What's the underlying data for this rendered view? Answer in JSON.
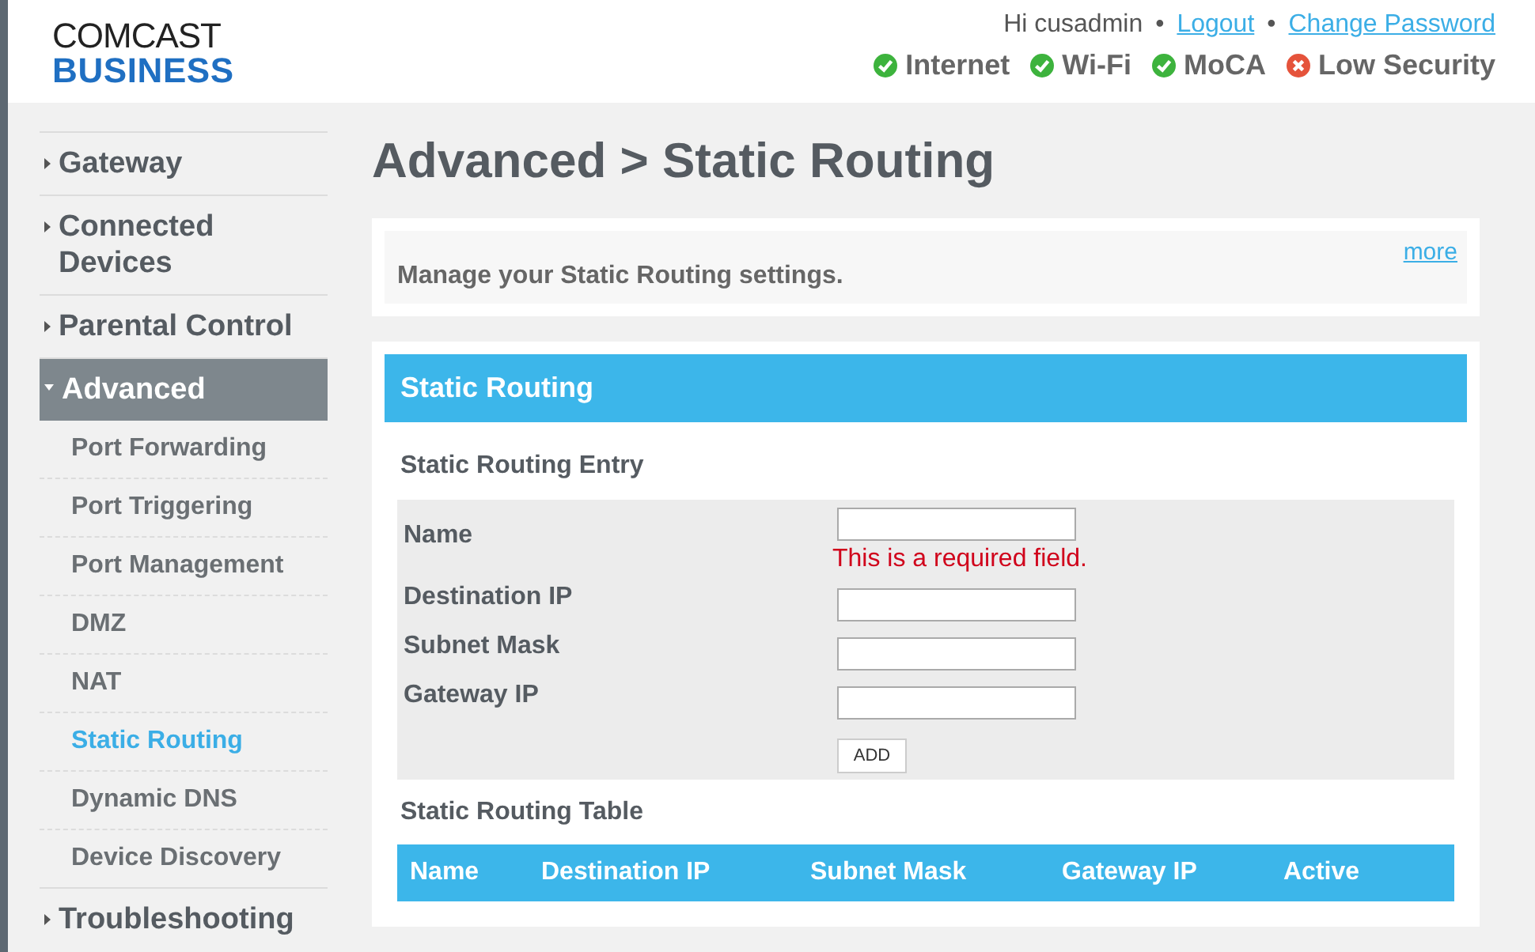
{
  "logo": {
    "line1": "COMCAST",
    "line2": "BUSINESS"
  },
  "user": {
    "greeting": "Hi cusadmin",
    "separator": "•",
    "logout": "Logout",
    "change_password": "Change Password"
  },
  "status": [
    {
      "label": "Internet",
      "kind": "ok"
    },
    {
      "label": "Wi-Fi",
      "kind": "ok"
    },
    {
      "label": "MoCA",
      "kind": "ok"
    },
    {
      "label": "Low Security",
      "kind": "error"
    }
  ],
  "sidebar": {
    "items": [
      {
        "label": "Gateway",
        "expanded": false,
        "selected": false
      },
      {
        "label": "Connected Devices",
        "expanded": false,
        "selected": false
      },
      {
        "label": "Parental Control",
        "expanded": false,
        "selected": false
      },
      {
        "label": "Advanced",
        "expanded": true,
        "selected": true,
        "children": [
          {
            "label": "Port Forwarding",
            "selected": false
          },
          {
            "label": "Port Triggering",
            "selected": false
          },
          {
            "label": "Port Management",
            "selected": false
          },
          {
            "label": "DMZ",
            "selected": false
          },
          {
            "label": "NAT",
            "selected": false
          },
          {
            "label": "Static Routing",
            "selected": true
          },
          {
            "label": "Dynamic DNS",
            "selected": false
          },
          {
            "label": "Device Discovery",
            "selected": false
          }
        ]
      },
      {
        "label": "Troubleshooting",
        "expanded": false,
        "selected": false
      }
    ]
  },
  "page_title": "Advanced > Static Routing",
  "intro": {
    "text": "Manage your Static Routing settings.",
    "more": "more"
  },
  "panel": {
    "title": "Static Routing",
    "entry_title": "Static Routing Entry",
    "fields": [
      {
        "label": "Name",
        "error": "This is a required field."
      },
      {
        "label": "Destination IP"
      },
      {
        "label": "Subnet Mask"
      },
      {
        "label": "Gateway IP"
      }
    ],
    "add_button": "ADD",
    "table_title": "Static Routing Table",
    "columns": [
      "Name",
      "Destination IP",
      "Subnet Mask",
      "Gateway IP",
      "Active"
    ]
  }
}
